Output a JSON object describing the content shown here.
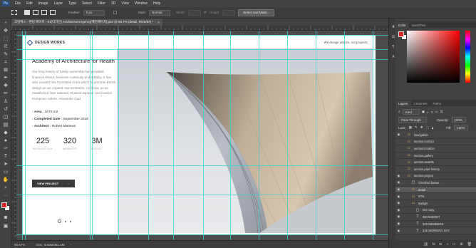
{
  "menu": {
    "logo": "Ps",
    "items": [
      "File",
      "Edit",
      "Image",
      "Layer",
      "Type",
      "Select",
      "Filter",
      "3D",
      "View",
      "Window",
      "Help"
    ]
  },
  "options": {
    "feather_label": "Feather:",
    "feather_value": "0 px",
    "style_label": "Style:",
    "style_value": "Normal",
    "width_label": "Width:",
    "height_label": "Height:",
    "select_mask_label": "Select and Mask..."
  },
  "document_tab": {
    "title": "코딩웍스 - 랜딩 페이지 - 01(디자인) ArchitectureAgency[메인페이지].psd @ 66.7% (detail, RGB/8#) *",
    "close": "×"
  },
  "status": {
    "zoom": "66.67%",
    "doc": "Doc: 5.93M/481.4M",
    "arrow": "›"
  },
  "design": {
    "brand": "DESIGN WORKS",
    "tagline": "We design places, not projects.",
    "heading": "Academy of Architecture for Health",
    "body": "Our long history of family ownership has provided financial resour, business continuity and stability. It has also created firm foundation from which to promote British design as we expand new territories. And now, as an established inter national, Musical Japaner and Central European culture. Alexander Gad.",
    "details": [
      {
        "label": "Area",
        "value": " : 1670 m2"
      },
      {
        "label": "Completed Date",
        "value": " : September 2018"
      },
      {
        "label": "Architect",
        "value": " : Robert Mattews"
      }
    ],
    "stats": [
      {
        "value": "225",
        "label": "WORKING DAY"
      },
      {
        "value": "320",
        "label": "MEMBERS"
      },
      {
        "value": "3M",
        "label": "BUDGET"
      }
    ],
    "cta": "VIEW PROJECT",
    "cta_arrow": "→",
    "dots_total": 3,
    "dots_active": 1
  },
  "panels": {
    "color_tabs": [
      "Color",
      "Swatches"
    ],
    "layer_tabs": [
      "Layers",
      "Channels",
      "Paths"
    ],
    "kind_label": "Kind",
    "blend": "Pass Through",
    "opacity_label": "Opacity:",
    "opacity_value": "100%",
    "lock_label": "Lock:",
    "fill_label": "Fill:",
    "fill_value": "100%",
    "layers": [
      {
        "name": "Navigation",
        "icon": "folder",
        "visible": true,
        "indent": 0
      },
      {
        "name": "section.contact",
        "icon": "folder",
        "visible": false,
        "indent": 0
      },
      {
        "name": "section.location",
        "icon": "folder",
        "visible": false,
        "indent": 0
      },
      {
        "name": "section.gallery",
        "icon": "folder",
        "visible": false,
        "indent": 0
      },
      {
        "name": "section.awards",
        "icon": "folder",
        "visible": false,
        "indent": 0
      },
      {
        "name": "section.plan-history",
        "icon": "folder",
        "visible": false,
        "indent": 0
      },
      {
        "name": "section.project",
        "icon": "folder",
        "visible": true,
        "indent": 0
      },
      {
        "name": "Checked button",
        "icon": "image",
        "visible": true,
        "indent": 1
      },
      {
        "name": "detail",
        "icon": "folder",
        "visible": true,
        "indent": 1,
        "selected": true
      },
      {
        "name": "BTN",
        "icon": "folder",
        "visible": true,
        "indent": 1
      },
      {
        "name": "Budget",
        "icon": "folder",
        "visible": true,
        "indent": 1
      },
      {
        "name": "line copy",
        "icon": "image",
        "visible": true,
        "indent": 2
      },
      {
        "name": "3M BUDGET",
        "icon": "text",
        "visible": true,
        "indent": 2
      },
      {
        "name": "320 MEMBERS",
        "icon": "text",
        "visible": true,
        "indent": 2
      },
      {
        "name": "225 WORKING DAY",
        "icon": "text",
        "visible": true,
        "indent": 2
      }
    ]
  },
  "colors": {
    "accent": "#36d1d1",
    "fg": "#d82525",
    "bg": "#ffffff"
  }
}
